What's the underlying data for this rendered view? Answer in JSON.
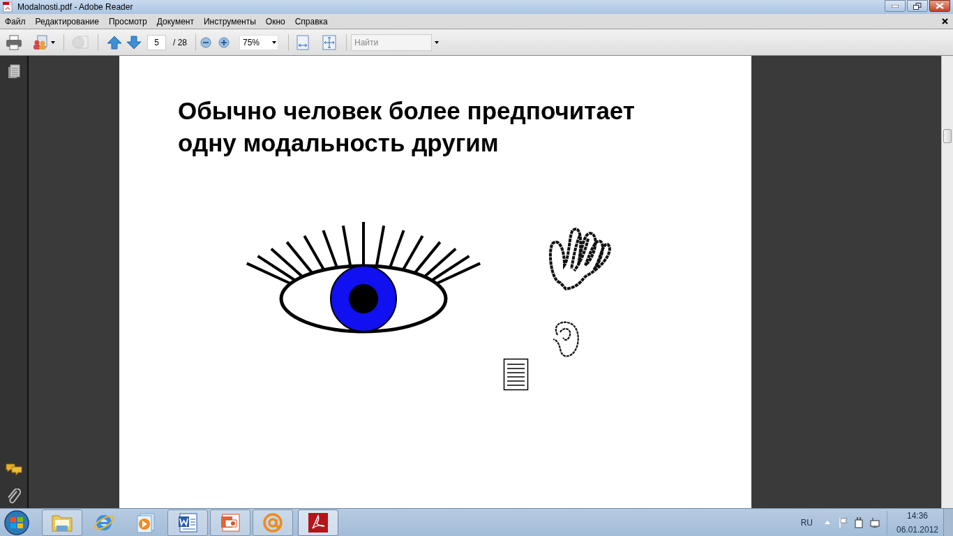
{
  "window": {
    "title": "Modalnosti.pdf - Adobe Reader"
  },
  "menu": [
    "Файл",
    "Редактирование",
    "Просмотр",
    "Документ",
    "Инструменты",
    "Окно",
    "Справка"
  ],
  "toolbar": {
    "page_number": "5",
    "page_total": "/ 28",
    "zoom": "75%",
    "search": {
      "placeholder": "Найти"
    }
  },
  "document": {
    "heading": "Обычно человек более предпочитает одну модальность другим"
  },
  "taskbar": {
    "language": "RU",
    "time": "14:36",
    "date": "06.01.2012"
  }
}
